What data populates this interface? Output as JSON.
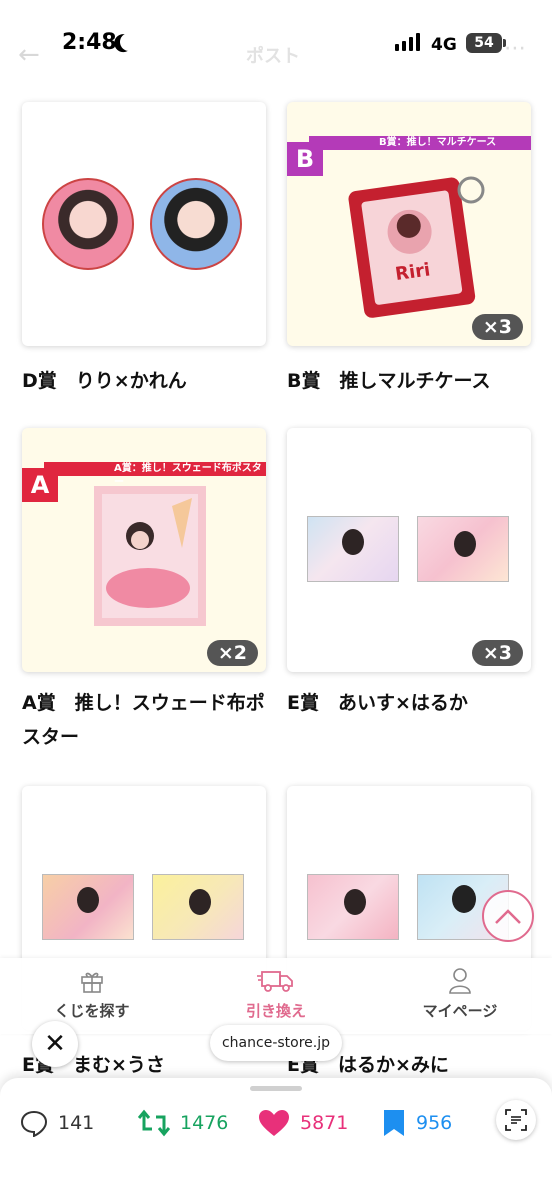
{
  "status_bar": {
    "time": "2:48",
    "network": "4G",
    "battery": "54",
    "faded_header_title": "ポスト"
  },
  "products": [
    {
      "title": "D賞　りり×かれん",
      "qty": "",
      "prize_letter": "",
      "prize_label": ""
    },
    {
      "title": "B賞　推しマルチケース",
      "qty": "×3",
      "prize_letter": "B",
      "prize_label": "B賞：推し！マルチケース",
      "case_text": "Riri"
    },
    {
      "title": "A賞　推し！スウェード布ポスター",
      "qty": "×2",
      "prize_letter": "A",
      "prize_label": "A賞：推し！スウェード布ポスター"
    },
    {
      "title": "E賞　あいす×はるか",
      "qty": "×3",
      "prize_letter": "",
      "prize_label": ""
    },
    {
      "title": "E賞　まむ×うさ",
      "qty": "",
      "prize_letter": "",
      "prize_label": ""
    },
    {
      "title": "E賞　はるか×みに",
      "qty": "",
      "prize_letter": "",
      "prize_label": ""
    }
  ],
  "app_nav": {
    "items": [
      {
        "label": "くじを探す",
        "icon": "gift-icon"
      },
      {
        "label": "引き換え",
        "icon": "truck-icon"
      },
      {
        "label": "マイページ",
        "icon": "person-icon"
      }
    ]
  },
  "url_pill": "chance-store.jp",
  "engagement": {
    "replies": "141",
    "reposts": "1476",
    "likes": "5871",
    "bookmarks": "956"
  },
  "colors": {
    "accent_pink": "#e06a8e",
    "prize_red": "#e0263f",
    "prize_magenta": "#b43ab8",
    "repost_green": "#17a35f",
    "like_pink": "#e8307a",
    "bookmark_blue": "#1d8ff0",
    "badge_gray": "#555555"
  }
}
